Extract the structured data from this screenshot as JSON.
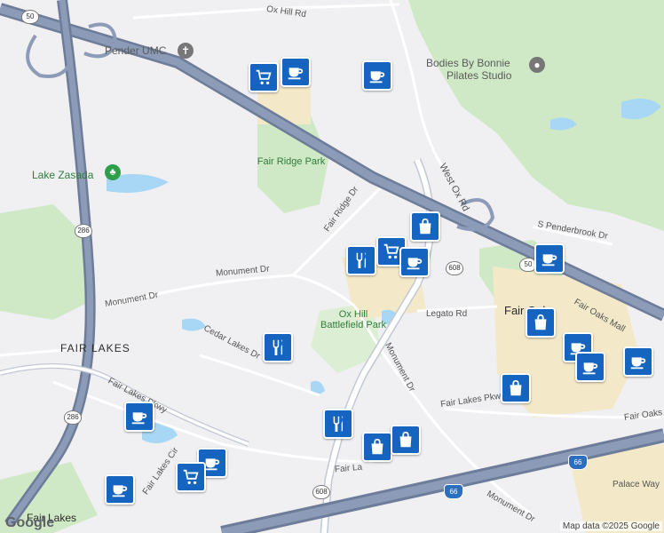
{
  "map": {
    "labels": {
      "ox_hill_rd": "Ox Hill Rd",
      "pender_umc": "Pender UMC",
      "bodies_by_bonnie": "Bodies By Bonnie",
      "pilates_studio": "Pilates Studio",
      "lake_zasada": "Lake Zasada",
      "fair_ridge_park": "Fair Ridge Park",
      "fair_ridge_dr": "Fair Ridge Dr",
      "west_ox_rd": "West Ox Rd",
      "s_penderbrook_dr": "S Penderbrook Dr",
      "monument_dr_west": "Monument Dr",
      "monument_dr_mid": "Monument Dr",
      "monument_dr_east": "Monument Dr",
      "monument_dr_south": "Monument Dr",
      "ox_hill_battlefield_park": "Ox Hill Battlefield Park",
      "legato_rd": "Legato Rd",
      "fair_oaks": "Fair Oaks",
      "fair_oaks_mall": "Fair Oaks Mall",
      "fair_lakes": "FAIR LAKES",
      "cedar_lakes_dr": "Cedar Lakes Dr",
      "fair_lakes_pkwy": "Fair Lakes Pkwy",
      "fair_lakes_pkwy_east": "Fair Lakes Pkwy",
      "fair_oaks_partial": "Fair Oaks",
      "fair_lakes_cir": "Fair Lakes Cir",
      "fair_lakes_short": "Fair La",
      "palace_way": "Palace Way",
      "fair_lakes_place": "Fair Lakes"
    },
    "shields": {
      "us50_top": "50",
      "us50_east": "50",
      "va286_north": "286",
      "va286_south": "286",
      "va608_east": "608",
      "va608_south": "608",
      "i66_east": "66",
      "i66_south": "66"
    },
    "attribution": "Map data ©2025 Google",
    "logo": "Google"
  },
  "colors": {
    "background": "#f0eff2",
    "park": "#cfe9c6",
    "water": "#a7d7f4",
    "highway": "#7b8aa6",
    "road": "#ffffff",
    "commercial": "#f3e9c9",
    "marker": "#1565c0"
  }
}
